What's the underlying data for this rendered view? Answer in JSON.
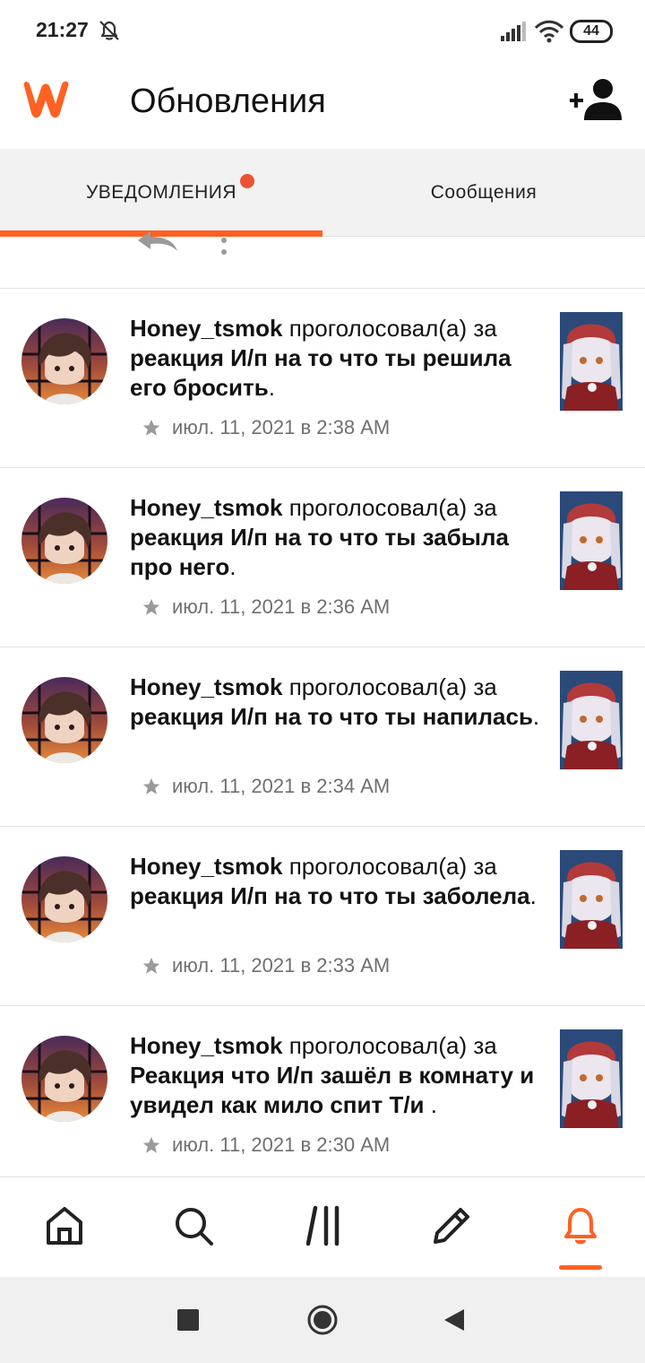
{
  "status": {
    "time": "21:27",
    "battery": "44",
    "icons": [
      "bell-off-icon",
      "signal-icon",
      "wifi-icon",
      "battery-icon"
    ]
  },
  "header": {
    "title": "Обновления",
    "logo_icon": "wattpad-logo",
    "action_icon": "add-user-icon"
  },
  "tabs": [
    {
      "label": "УВЕДОМЛЕНИЯ",
      "active": true,
      "has_dot": true
    },
    {
      "label": "Сообщения",
      "active": false
    }
  ],
  "notifications": [
    {
      "user": "Honey_tsmok",
      "action": " проголосовал(а) за ",
      "story": "реакция И/п на то что ты решила его бросить",
      "tail": ".",
      "time": "июл. 11, 2021 в 2:38 AM"
    },
    {
      "user": "Honey_tsmok",
      "action": " проголосовал(а) за ",
      "story": "реакция И/п на то что ты забыла про него",
      "tail": ".",
      "time": "июл. 11, 2021 в 2:36 AM"
    },
    {
      "user": "Honey_tsmok",
      "action": " проголосовал(а) за ",
      "story": "реакция И/п на то что ты напилась",
      "tail": ".",
      "time": "июл. 11, 2021 в 2:34 AM"
    },
    {
      "user": "Honey_tsmok",
      "action": " проголосовал(а) за ",
      "story": "реакция И/п на то что ты заболела",
      "tail": ".",
      "time": "июл. 11, 2021 в 2:33 AM"
    },
    {
      "user": "Honey_tsmok",
      "action": " проголосовал(а) за ",
      "story": "Реакция что И/п зашёл в комнату и увидел как мило спит Т/и ",
      "tail": ".",
      "time": "июл. 11, 2021 в 2:30 AM"
    }
  ],
  "bottom_nav": [
    {
      "icon": "home-icon",
      "active": false
    },
    {
      "icon": "search-icon",
      "active": false
    },
    {
      "icon": "library-icon",
      "active": false
    },
    {
      "icon": "pencil-icon",
      "active": false
    },
    {
      "icon": "bell-icon",
      "active": true
    }
  ],
  "colors": {
    "accent": "#ff6122",
    "dot": "#eb5233",
    "text": "#121212",
    "muted": "#6f6f6f"
  }
}
